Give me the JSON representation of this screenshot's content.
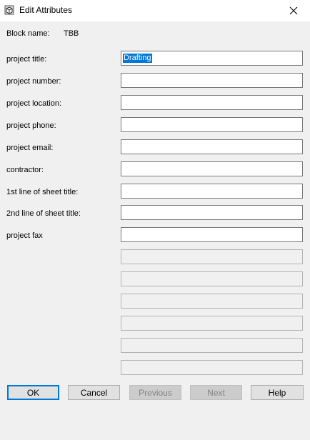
{
  "window": {
    "title": "Edit Attributes",
    "close_glyph": "✕"
  },
  "block": {
    "label": "Block name:",
    "value": "TBB"
  },
  "attributes": [
    {
      "label": "project title:",
      "value": "Drafting",
      "selected": true
    },
    {
      "label": "project number:",
      "value": ""
    },
    {
      "label": "project location:",
      "value": ""
    },
    {
      "label": "project phone:",
      "value": ""
    },
    {
      "label": "project email:",
      "value": ""
    },
    {
      "label": "contractor:",
      "value": ""
    },
    {
      "label": "1st line of sheet title:",
      "value": ""
    },
    {
      "label": "2nd line of sheet title:",
      "value": ""
    },
    {
      "label": "project fax",
      "value": ""
    }
  ],
  "buttons": {
    "ok": "OK",
    "cancel": "Cancel",
    "previous": "Previous",
    "next": "Next",
    "help": "Help"
  },
  "colors": {
    "accent": "#0078d7",
    "background": "#f0f0f0"
  }
}
